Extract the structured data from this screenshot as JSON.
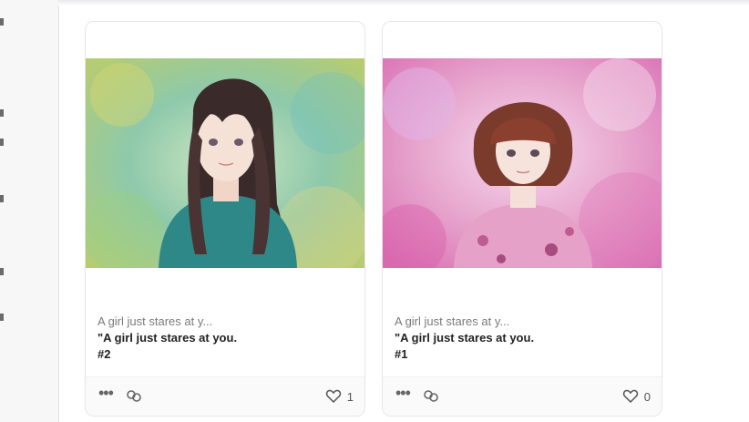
{
  "cards": [
    {
      "short_title": "A girl just stares at y...",
      "full_title": "\"A girl just stares at you.",
      "number": "#2",
      "likes": "1",
      "icons": {
        "more": "more-dots-icon",
        "link": "link-icon",
        "like": "heart-icon"
      }
    },
    {
      "short_title": "A girl just stares at y...",
      "full_title": "\"A girl just stares at you.",
      "number": "#1",
      "likes": "0",
      "icons": {
        "more": "more-dots-icon",
        "link": "link-icon",
        "like": "heart-icon"
      }
    }
  ],
  "colors": {
    "card_border": "#e6e6ea",
    "footer_bg": "#fafafb",
    "bg1_green": "#9fcf9a",
    "bg2_pink": "#e7a6cd"
  }
}
